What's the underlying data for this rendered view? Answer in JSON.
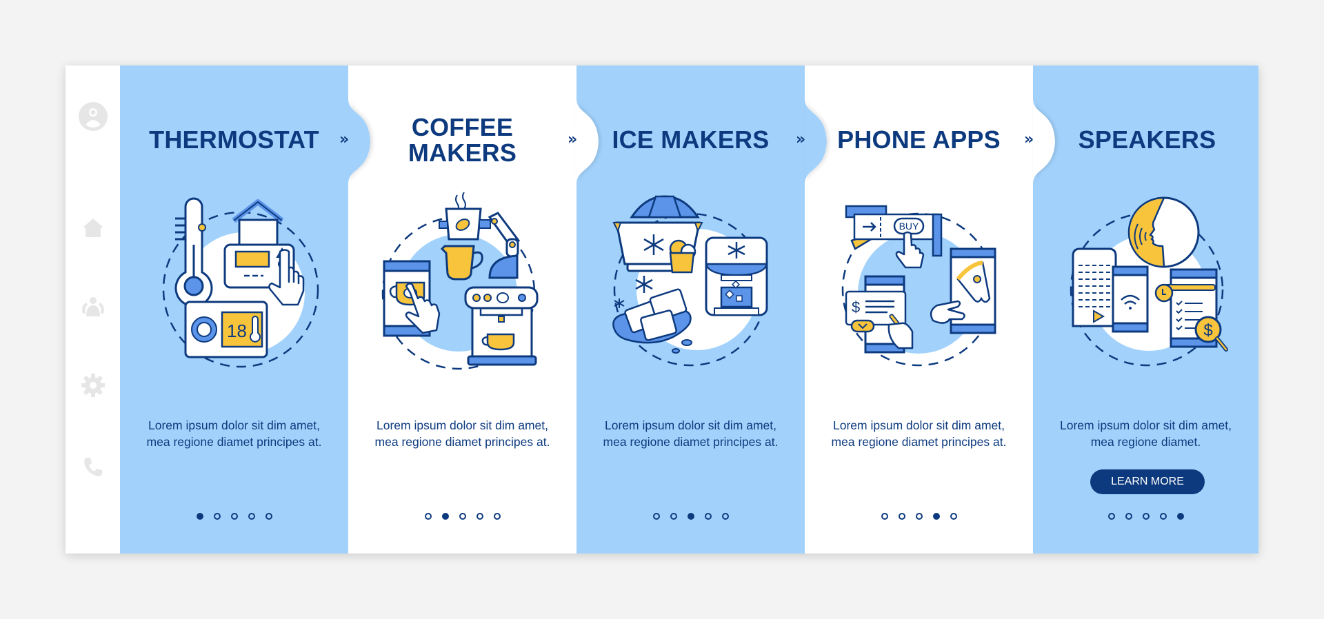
{
  "sidebar": {
    "items": [
      {
        "icon": "user-icon"
      },
      {
        "icon": "home-icon"
      },
      {
        "icon": "group-icon"
      },
      {
        "icon": "gear-icon"
      },
      {
        "icon": "phone-icon"
      }
    ]
  },
  "colors": {
    "blue_panel": "#a2d2fc",
    "white_panel": "#ffffff",
    "navy": "#0d3a7e",
    "accent_blue": "#5b94e8",
    "yellow": "#f8c43c",
    "background": "#f3f3f3"
  },
  "chevron": "»",
  "screens": [
    {
      "title": "THERMOSTAT",
      "description": "Lorem ipsum dolor sit dim amet, mea regione diamet principes at.",
      "active_dot": 1,
      "illustration": "thermostat-illustration",
      "thermostat_reading": "18"
    },
    {
      "title_line1": "COFFEE",
      "title_line2": "MAKERS",
      "description": "Lorem ipsum dolor sit dim amet, mea regione diamet principes at.",
      "active_dot": 2,
      "illustration": "coffee-maker-illustration"
    },
    {
      "title": "ICE MAKERS",
      "description": "Lorem ipsum dolor sit dim amet, mea regione diamet principes at.",
      "active_dot": 3,
      "illustration": "ice-maker-illustration"
    },
    {
      "title": "PHONE APPS",
      "description": "Lorem ipsum dolor sit dim amet, mea regione diamet principes at.",
      "active_dot": 4,
      "illustration": "phone-apps-illustration",
      "buy_label": "BUY"
    },
    {
      "title": "SPEAKERS",
      "description": "Lorem ipsum dolor sit dim amet, mea regione diamet.",
      "active_dot": 5,
      "illustration": "speakers-illustration",
      "button_label": "LEARN MORE"
    }
  ],
  "pagination": {
    "total": 5
  }
}
